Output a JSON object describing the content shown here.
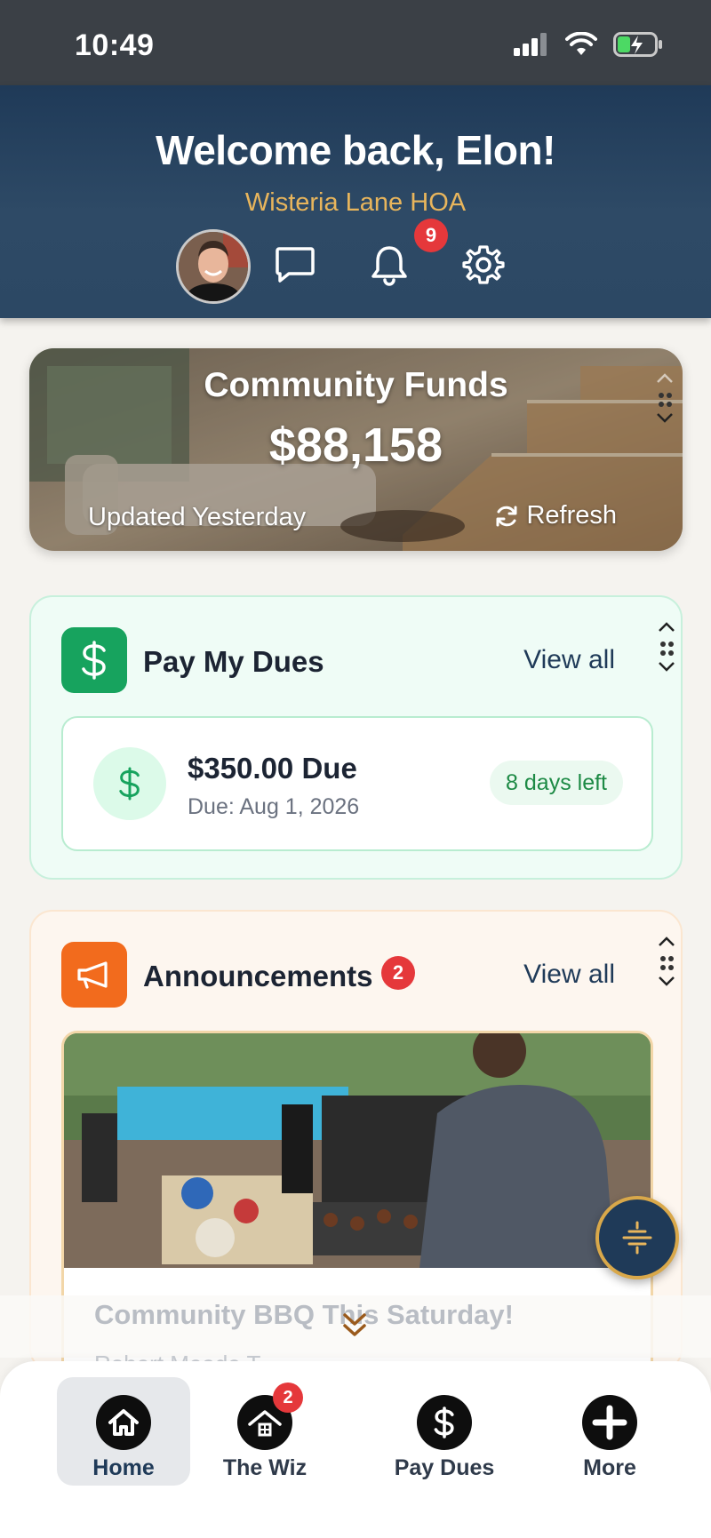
{
  "status_bar": {
    "time": "10:49"
  },
  "header": {
    "welcome": "Welcome back, Elon!",
    "hoa_name": "Wisteria Lane HOA",
    "notifications_count": "9"
  },
  "funds": {
    "title": "Community Funds",
    "amount": "$88,158",
    "updated": "Updated Yesterday",
    "refresh_label": "Refresh"
  },
  "dues": {
    "title": "Pay My Dues",
    "view_all": "View all",
    "amount": "$350.00 Due",
    "due_date": "Due: Aug 1, 2026",
    "days_left": "8 days left"
  },
  "announcements": {
    "title": "Announcements",
    "count": "2",
    "view_all": "View all",
    "item_title": "Community BBQ This Saturday!",
    "item_author": "Robert Meade T..."
  },
  "nav": {
    "items": [
      {
        "label": "Home",
        "icon": "home-icon"
      },
      {
        "label": "The Wiz",
        "icon": "wiz-house-icon",
        "badge": "2"
      },
      {
        "label": "Pay Dues",
        "icon": "dollar-icon"
      },
      {
        "label": "More",
        "icon": "plus-icon"
      }
    ]
  },
  "colors": {
    "header_bg": "#1f3a58",
    "accent_gold": "#e8b55c",
    "dues_green": "#17a35e",
    "announce_orange": "#f26b1d",
    "badge_red": "#e5383b"
  }
}
